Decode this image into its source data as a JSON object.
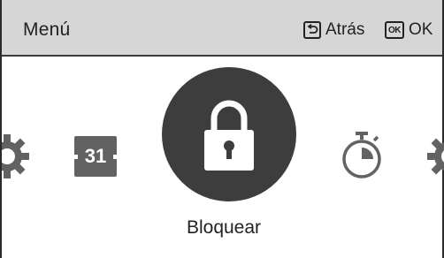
{
  "header": {
    "title": "Menú",
    "back_label": "Atrás",
    "ok_label": "OK",
    "ok_key": "OK"
  },
  "menu": {
    "items": [
      {
        "icon": "gear-icon"
      },
      {
        "icon": "calendar-icon",
        "text": "31"
      },
      {
        "icon": "lock-icon",
        "label": "Bloquear",
        "selected": true
      },
      {
        "icon": "timer-icon"
      },
      {
        "icon": "gear-icon"
      }
    ]
  },
  "colors": {
    "header_bg": "#d6d6d6",
    "selected_circle": "#3d3d3d",
    "icon_gray": "#626262"
  }
}
